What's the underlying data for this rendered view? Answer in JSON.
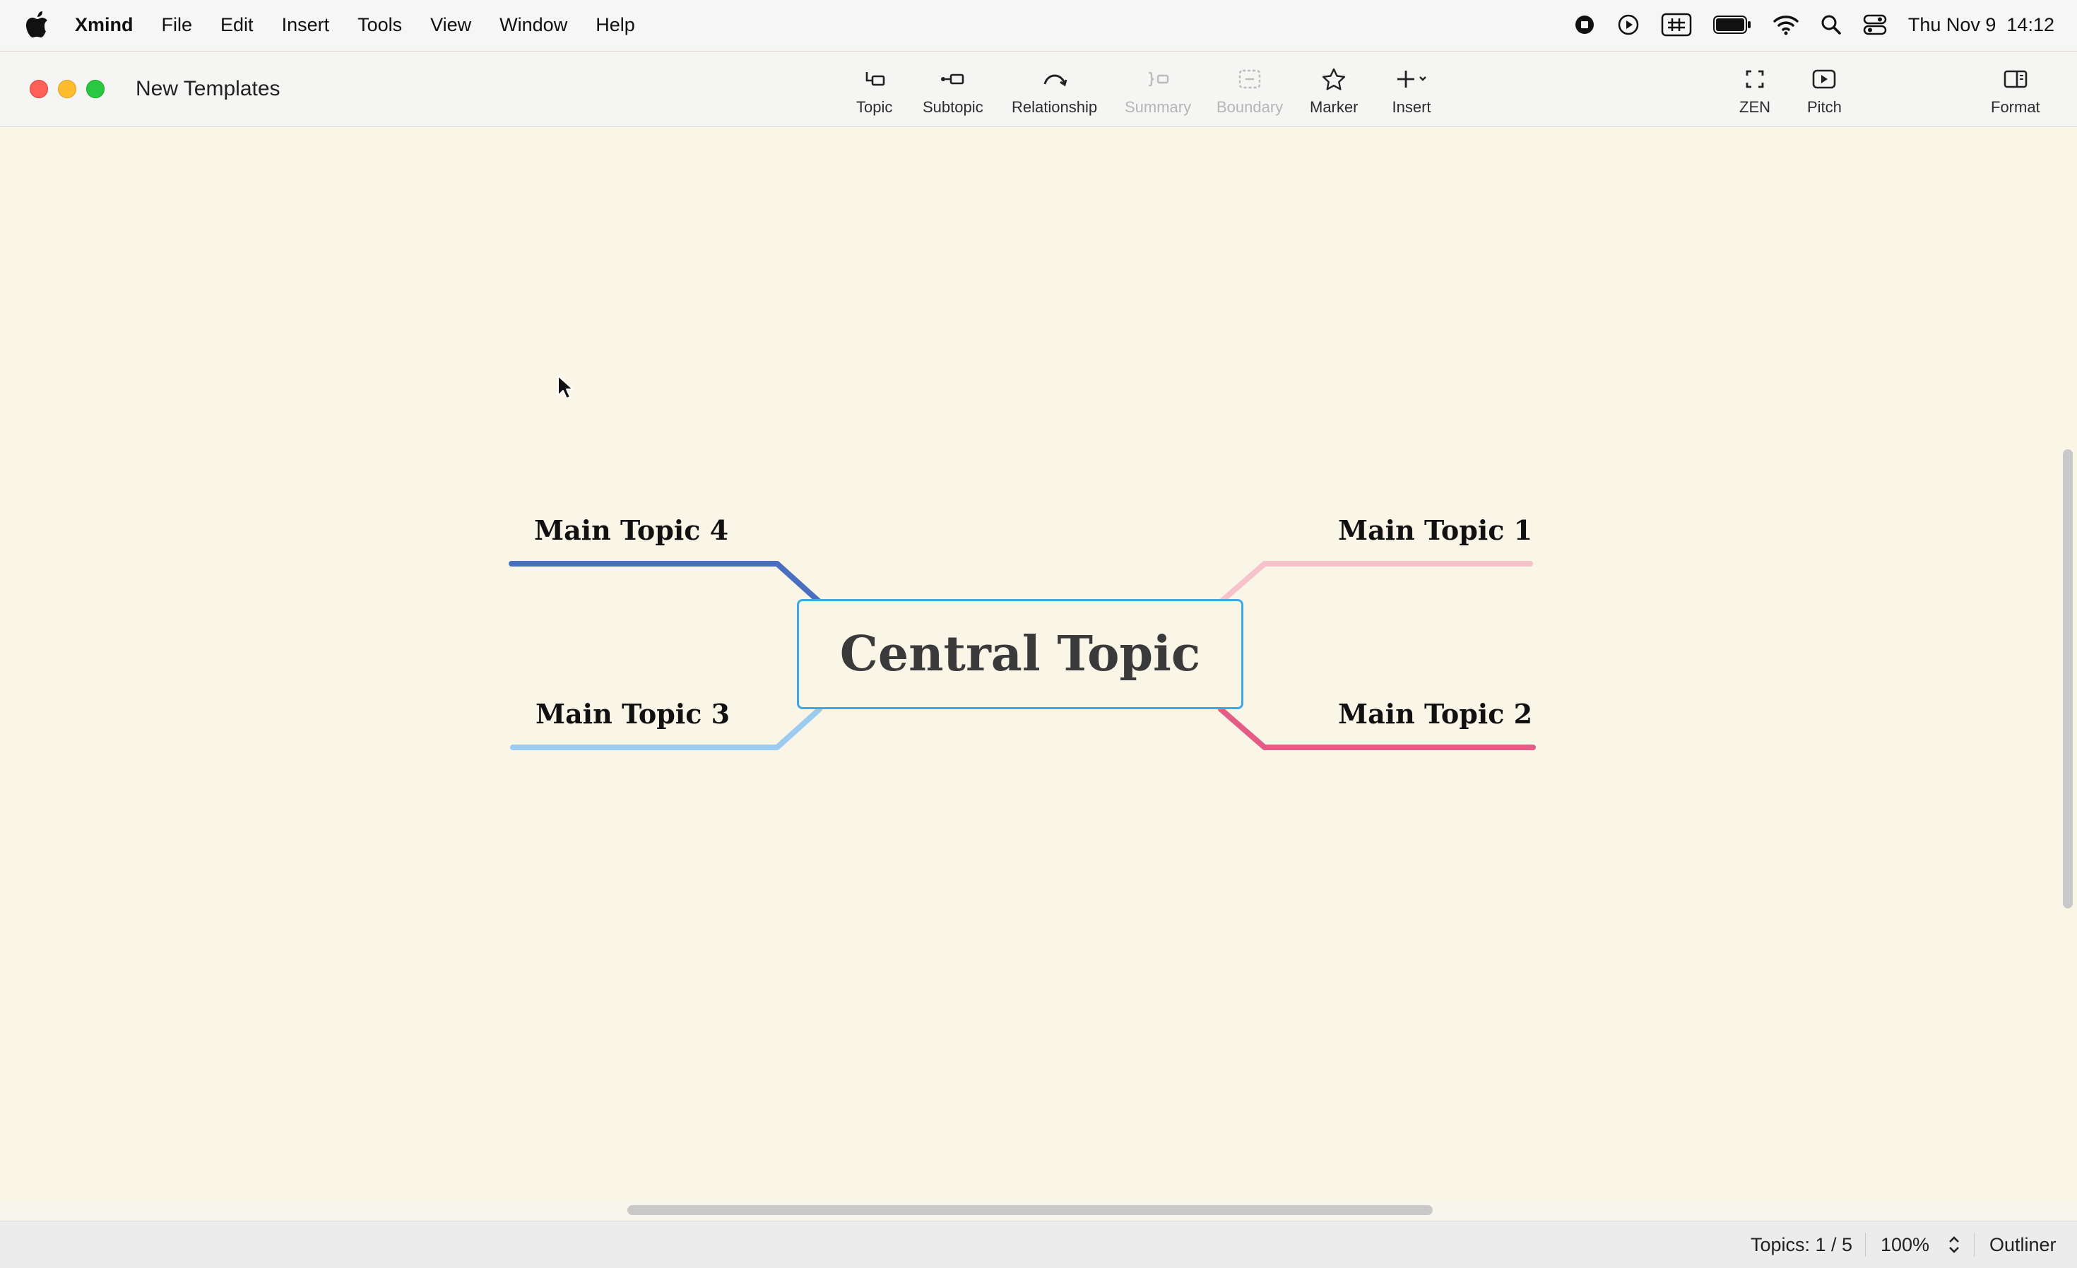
{
  "menubar": {
    "app_name": "Xmind",
    "items": [
      "File",
      "Edit",
      "Insert",
      "Tools",
      "View",
      "Window",
      "Help"
    ],
    "clock": "Thu Nov 9  14:12",
    "status_icons": [
      "record-icon",
      "play-icon",
      "input-method-icon",
      "battery-icon",
      "wifi-icon",
      "spotlight-icon",
      "control-center-icon"
    ]
  },
  "window": {
    "title": "New Templates"
  },
  "toolbar": {
    "topic": "Topic",
    "subtopic": "Subtopic",
    "relationship": "Relationship",
    "summary": "Summary",
    "boundary": "Boundary",
    "marker": "Marker",
    "insert": "Insert",
    "zen": "ZEN",
    "pitch": "Pitch",
    "format": "Format"
  },
  "mindmap": {
    "central_topic": "Central Topic",
    "branches": [
      {
        "label": "Main Topic 1",
        "color": "#f6c3cc"
      },
      {
        "label": "Main Topic 2",
        "color": "#e35d86"
      },
      {
        "label": "Main Topic 3",
        "color": "#9ccbf0"
      },
      {
        "label": "Main Topic 4",
        "color": "#4a6fbf"
      }
    ],
    "central_border_color": "#3aa9e6",
    "background": "#f9f6e8"
  },
  "statusbar": {
    "topics": "Topics: 1 / 5",
    "zoom": "100%",
    "outliner": "Outliner"
  }
}
